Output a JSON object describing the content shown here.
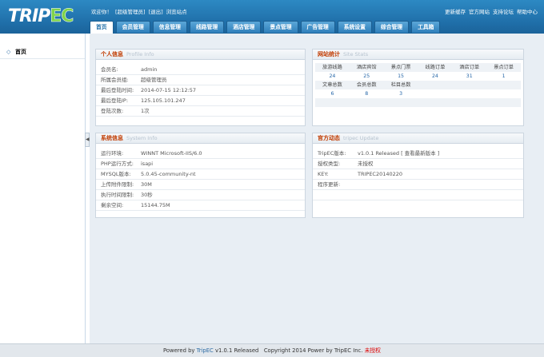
{
  "header": {
    "logo_a": "TRIP",
    "logo_b": "EC",
    "welcome": "欢迎你！",
    "user": "[超级管理员]",
    "logout": "[退出]",
    "browse": "浏览站点",
    "links": [
      "更新缓存",
      "官方网站",
      "支持论坛",
      "帮助中心"
    ]
  },
  "nav": [
    "首页",
    "会员管理",
    "信息管理",
    "线路管理",
    "酒店管理",
    "景点管理",
    "广告管理",
    "系统设置",
    "综合管理",
    "工具箱"
  ],
  "sidebar": {
    "home": "首页"
  },
  "profile": {
    "title": "个人信息",
    "title_en": "Profile Info",
    "rows": [
      {
        "k": "会员名:",
        "v": "admin"
      },
      {
        "k": "所属会员组:",
        "v": "超级管理员"
      },
      {
        "k": "最后登陆时间:",
        "v": "2014-07-15 12:12:57"
      },
      {
        "k": "最后登陆IP:",
        "v": "125.105.101.247"
      },
      {
        "k": "登陆次数:",
        "v": "1次"
      }
    ]
  },
  "stats": {
    "title": "网站统计",
    "title_en": "Site Stats",
    "row1_labels": [
      "旅游线路",
      "酒店宾馆",
      "景点门票",
      "线路订单",
      "酒店订单",
      "景点订单"
    ],
    "row1_values": [
      "24",
      "25",
      "15",
      "24",
      "31",
      "1"
    ],
    "row2_labels": [
      "文章总数",
      "会员总数",
      "栏目总数"
    ],
    "row2_values": [
      "6",
      "8",
      "3"
    ]
  },
  "system": {
    "title": "系统信息",
    "title_en": "System Info",
    "rows": [
      {
        "k": "运行环境:",
        "v": "WINNT Microsoft-IIS/6.0"
      },
      {
        "k": "PHP运行方式:",
        "v": "isapi"
      },
      {
        "k": "MYSQL版本:",
        "v": "5.0.45-community-nt"
      },
      {
        "k": "上传附件限制:",
        "v": "30M"
      },
      {
        "k": "执行时间限制:",
        "v": "30秒"
      },
      {
        "k": "剩余空间:",
        "v": "15144.75M"
      }
    ]
  },
  "official": {
    "title": "官方动态",
    "title_en": "tripec Update",
    "version_k": "TripEC版本:",
    "version_v": "v1.0.1 Released",
    "check_link": "[ 查看最新版本 ]",
    "license_k": "授权类型:",
    "license_v": "未授权",
    "key_k": "KEY:",
    "key_v": "TRIPEC20140220",
    "update_k": "程序更新:"
  },
  "footer": {
    "powered": "Powered by",
    "brand": "TripEC",
    "version": "v1.0.1 Released",
    "copyright": "Copyright 2014 Power by TripEC Inc.",
    "unlicensed": "未授权"
  }
}
